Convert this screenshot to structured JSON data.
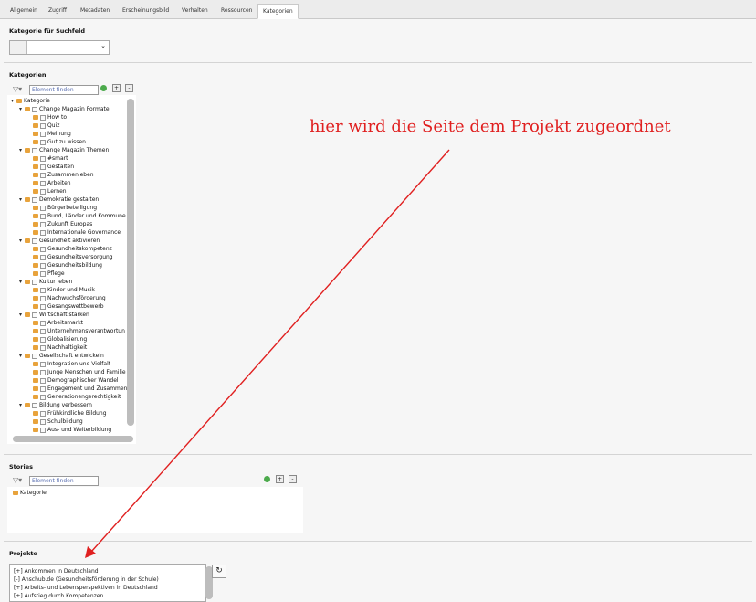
{
  "tabs": [
    "Allgemein",
    "Zugriff",
    "Metadaten",
    "Erscheinungsbild",
    "Verhalten",
    "Ressourcen",
    "Kategorien"
  ],
  "active_tab": "Kategorien",
  "kategorie_suchfeld": {
    "title": "Kategorie für Suchfeld",
    "value": ""
  },
  "kategorien": {
    "title": "Kategorien",
    "filter_placeholder": "Element finden",
    "tree": [
      {
        "label": "Kategorie",
        "level": 0,
        "expanded": true,
        "checkbox": false
      },
      {
        "label": "Change Magazin Formate",
        "level": 1,
        "expanded": true,
        "checkbox": true
      },
      {
        "label": "How to",
        "level": 2,
        "checkbox": true
      },
      {
        "label": "Quiz",
        "level": 2,
        "checkbox": true
      },
      {
        "label": "Meinung",
        "level": 2,
        "checkbox": true
      },
      {
        "label": "Gut zu wissen",
        "level": 2,
        "checkbox": true
      },
      {
        "label": "Change Magazin Themen",
        "level": 1,
        "expanded": true,
        "checkbox": true
      },
      {
        "label": "#smart",
        "level": 2,
        "checkbox": true
      },
      {
        "label": "Gestalten",
        "level": 2,
        "checkbox": true
      },
      {
        "label": "Zusammenleben",
        "level": 2,
        "checkbox": true
      },
      {
        "label": "Arbeiten",
        "level": 2,
        "checkbox": true
      },
      {
        "label": "Lernen",
        "level": 2,
        "checkbox": true
      },
      {
        "label": "Demokratie gestalten",
        "level": 1,
        "expanded": true,
        "checkbox": true
      },
      {
        "label": "Bürgerbeteiligung",
        "level": 2,
        "checkbox": true
      },
      {
        "label": "Bund, Länder und Kommune",
        "level": 2,
        "checkbox": true
      },
      {
        "label": "Zukunft Europas",
        "level": 2,
        "checkbox": true
      },
      {
        "label": "Internationale Governance",
        "level": 2,
        "checkbox": true
      },
      {
        "label": "Gesundheit aktivieren",
        "level": 1,
        "expanded": true,
        "checkbox": true
      },
      {
        "label": "Gesundheitskompetenz",
        "level": 2,
        "checkbox": true
      },
      {
        "label": "Gesundheitsversorgung",
        "level": 2,
        "checkbox": true
      },
      {
        "label": "Gesundheitsbildung",
        "level": 2,
        "checkbox": true
      },
      {
        "label": "Pflege",
        "level": 2,
        "checkbox": true
      },
      {
        "label": "Kultur leben",
        "level": 1,
        "expanded": true,
        "checkbox": true
      },
      {
        "label": "Kinder und Musik",
        "level": 2,
        "checkbox": true
      },
      {
        "label": "Nachwuchsförderung",
        "level": 2,
        "checkbox": true
      },
      {
        "label": "Gesangswettbewerb",
        "level": 2,
        "checkbox": true
      },
      {
        "label": "Wirtschaft stärken",
        "level": 1,
        "expanded": true,
        "checkbox": true
      },
      {
        "label": "Arbeitsmarkt",
        "level": 2,
        "checkbox": true
      },
      {
        "label": "Unternehmensverantwortun",
        "level": 2,
        "checkbox": true
      },
      {
        "label": "Globalisierung",
        "level": 2,
        "checkbox": true
      },
      {
        "label": "Nachhaltigkeit",
        "level": 2,
        "checkbox": true
      },
      {
        "label": "Gesellschaft entwickeln",
        "level": 1,
        "expanded": true,
        "checkbox": true
      },
      {
        "label": "Integration und Vielfalt",
        "level": 2,
        "checkbox": true
      },
      {
        "label": "Junge Menschen und Familie",
        "level": 2,
        "checkbox": true
      },
      {
        "label": "Demographischer Wandel",
        "level": 2,
        "checkbox": true
      },
      {
        "label": "Engagement und Zusammen",
        "level": 2,
        "checkbox": true
      },
      {
        "label": "Generationengerechtigkeit",
        "level": 2,
        "checkbox": true
      },
      {
        "label": "Bildung verbessern",
        "level": 1,
        "expanded": true,
        "checkbox": true
      },
      {
        "label": "Frühkindliche Bildung",
        "level": 2,
        "checkbox": true
      },
      {
        "label": "Schulbildung",
        "level": 2,
        "checkbox": true
      },
      {
        "label": "Aus- und Weiterbildung",
        "level": 2,
        "checkbox": true
      }
    ]
  },
  "stories": {
    "title": "Stories",
    "filter_placeholder": "Element finden",
    "tree": [
      {
        "label": "Kategorie"
      }
    ]
  },
  "projekte": {
    "title": "Projekte",
    "items": [
      "[+] Ankommen in Deutschland",
      "[-] Anschub.de (Gesundheitsförderung in der Schule)",
      "[+] Arbeits- und Lebensperspektiven in Deutschland",
      "[+] Aufstieg durch Kompetenzen"
    ]
  },
  "annotation": "hier wird die Seite dem Projekt zugeordnet",
  "colors": {
    "annotation": "#e02020",
    "folder_icon": "#e8a33c",
    "tree_bg": "#ffffff"
  },
  "icons": {
    "filter": "filter-icon",
    "expand": "expand-all-icon",
    "collapse": "collapse-all-icon",
    "refresh": "refresh-icon",
    "undo": "undo-icon"
  }
}
